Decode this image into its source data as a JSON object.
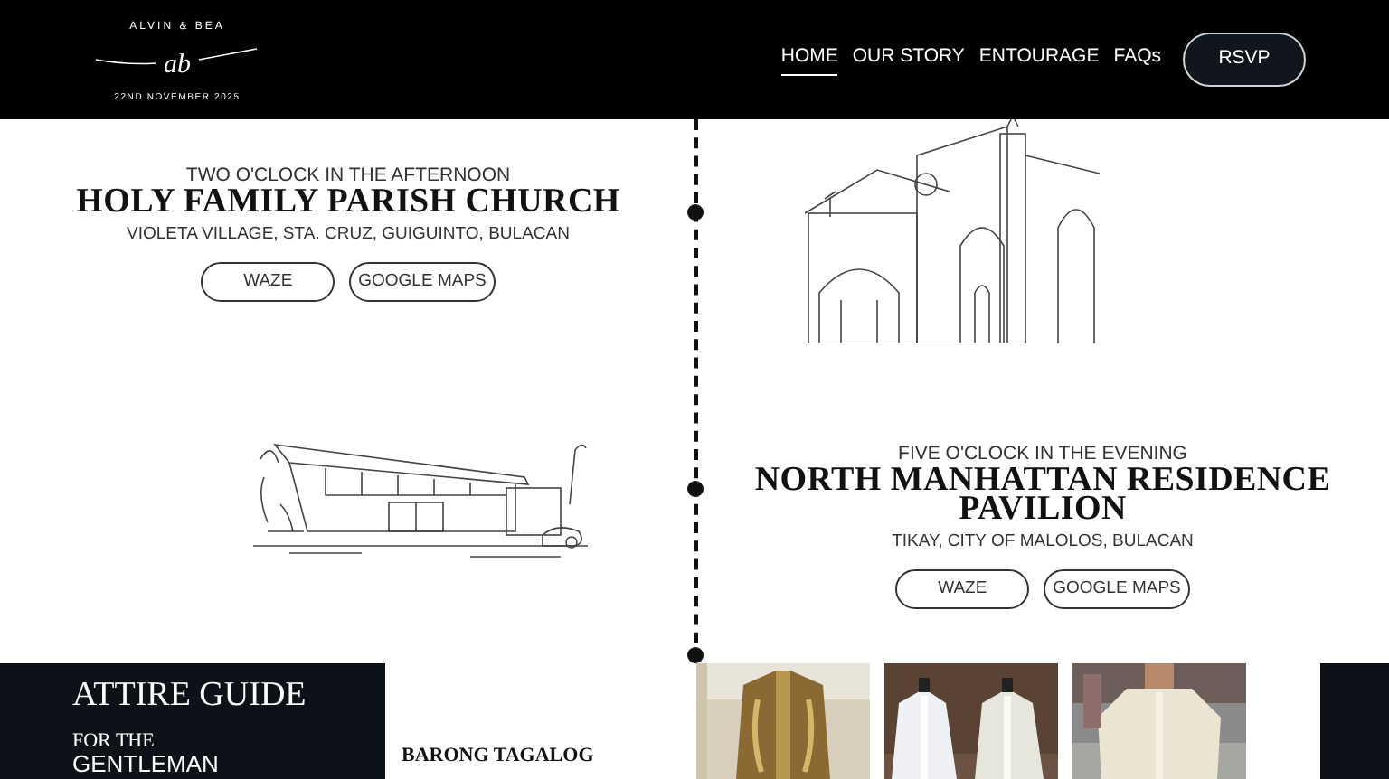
{
  "nav": {
    "logo": {
      "top_text": "ALVIN & BEA",
      "monogram": "ab",
      "bottom_text": "22ND NOVEMBER 2025"
    },
    "links": [
      {
        "label": "HOME",
        "selected": true
      },
      {
        "label": "OUR STORY",
        "selected": false
      },
      {
        "label": "ENTOURAGE",
        "selected": false
      },
      {
        "label": "FAQs",
        "selected": false
      }
    ],
    "rsvp": "RSVP"
  },
  "events": [
    {
      "time": "TWO O'CLOCK IN THE AFTERNOON",
      "venue": "HOLY FAMILY PARISH CHURCH",
      "address": "VIOLETA VILLAGE, STA. CRUZ, GUIGUINTO, BULACAN",
      "buttons": [
        "WAZE",
        "GOOGLE MAPS"
      ],
      "kind": "church"
    },
    {
      "time": "FIVE O'CLOCK IN THE EVENING",
      "venue": "NORTH MANHATTAN RESIDENCE PAVILION",
      "address": "TIKAY, CITY OF MALOLOS, BULACAN",
      "buttons": [
        "WAZE",
        "GOOGLE MAPS"
      ],
      "kind": "pavilion"
    }
  ],
  "attire": {
    "title": "ATTIRE GUIDE",
    "subtitle": "FOR THE",
    "audience": "GENTLEMAN",
    "item_label": "BARONG TAGALOG"
  }
}
